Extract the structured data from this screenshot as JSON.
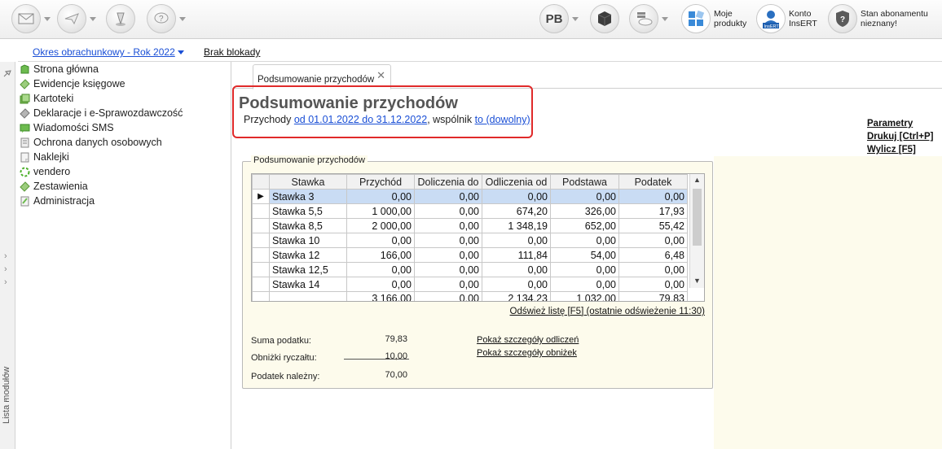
{
  "toolbar": {
    "product_logo_text": "PB",
    "moje_produkty_line1": "Moje",
    "moje_produkty_line2": "produkty",
    "konto_line1": "Konto",
    "konto_line2": "InsERT",
    "konto_badge": "InsERT",
    "stan_line1": "Stan abonamentu",
    "stan_line2": "nieznany!"
  },
  "subbar": {
    "period_label": "Okres obrachunkowy - Rok 2022",
    "block_label": "Brak blokady"
  },
  "leftstrip": {
    "vertical_label": "Lista modułów"
  },
  "nav": {
    "items": [
      {
        "label": "Strona główna",
        "icon": "home-icon"
      },
      {
        "label": "Ewidencje księgowe",
        "icon": "ledger-icon"
      },
      {
        "label": "Kartoteki",
        "icon": "cards-icon"
      },
      {
        "label": "Deklaracje i e-Sprawozdawczość",
        "icon": "declaration-icon"
      },
      {
        "label": "Wiadomości SMS",
        "icon": "sms-icon"
      },
      {
        "label": "Ochrona danych osobowych",
        "icon": "data-protection-icon"
      },
      {
        "label": "Naklejki",
        "icon": "stickers-icon"
      },
      {
        "label": "vendero",
        "icon": "vendero-icon"
      },
      {
        "label": "Zestawienia",
        "icon": "reports-icon"
      },
      {
        "label": "Administracja",
        "icon": "admin-icon"
      }
    ]
  },
  "tab": {
    "label": "Podsumowanie przychodów",
    "close": "✕"
  },
  "page": {
    "title": "Podsumowanie przychodów",
    "subtitle_prefix": "Przychody",
    "date_range": "od 01.01.2022 do 31.12.2022",
    "subtitle_mid": ", wspólnik",
    "partner": "to (dowolny)"
  },
  "right_links": {
    "parametry": "Parametry",
    "drukuj": "Drukuj [Ctrl+P]",
    "wylicz": "Wylicz [F5]"
  },
  "summary": {
    "group_title": "Podsumowanie przychodów",
    "columns": [
      "Stawka",
      "Przychód",
      "Doliczenia do",
      "Odliczenia od",
      "Podstawa",
      "Podatek"
    ],
    "rows": [
      [
        "Stawka 3",
        "0,00",
        "0,00",
        "0,00",
        "0,00",
        "0,00"
      ],
      [
        "Stawka 5,5",
        "1 000,00",
        "0,00",
        "674,20",
        "326,00",
        "17,93"
      ],
      [
        "Stawka 8,5",
        "2 000,00",
        "0,00",
        "1 348,19",
        "652,00",
        "55,42"
      ],
      [
        "Stawka 10",
        "0,00",
        "0,00",
        "0,00",
        "0,00",
        "0,00"
      ],
      [
        "Stawka 12",
        "166,00",
        "0,00",
        "111,84",
        "54,00",
        "6,48"
      ],
      [
        "Stawka 12,5",
        "0,00",
        "0,00",
        "0,00",
        "0,00",
        "0,00"
      ],
      [
        "Stawka 14",
        "0,00",
        "0,00",
        "0,00",
        "0,00",
        "0,00"
      ]
    ],
    "totals": [
      "",
      "3 166,00",
      "0,00",
      "2 134,23",
      "1 032,00",
      "79,83"
    ],
    "selected_row": 0,
    "refresh_label": "Odśwież listę [F5] (ostatnie odświeżenie 11:30)",
    "suma_label": "Suma podatku:",
    "suma_value": "79,83",
    "obnizki_label": "Obniżki ryczałtu:",
    "obnizki_value": "10,00",
    "nalezny_label": "Podatek należny:",
    "nalezny_value": "70,00",
    "link_odliczen": "Pokaż szczegóły odliczeń",
    "link_obnizek": "Pokaż szczegóły obniżek"
  },
  "colors": {
    "highlight": "#e02a2a",
    "link": "#1a4fd6",
    "selected_row": "#c9dcf4",
    "panel_bg": "#fdfbec"
  }
}
